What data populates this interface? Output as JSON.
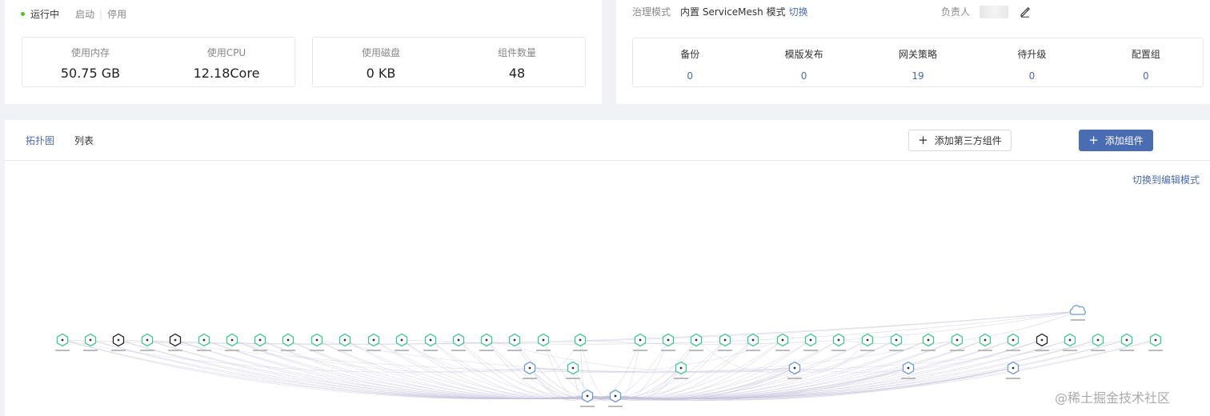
{
  "left_card": {
    "status": "运行中",
    "actions": [
      "启动",
      "停用"
    ],
    "metrics_a": [
      {
        "label": "使用内存",
        "value": "50.75 GB"
      },
      {
        "label": "使用CPU",
        "value": "12.18Core"
      }
    ],
    "metrics_b": [
      {
        "label": "使用磁盘",
        "value": "0 KB"
      },
      {
        "label": "组件数量",
        "value": "48"
      }
    ]
  },
  "right_card": {
    "gov_label": "治理模式",
    "gov_value": "内置 ServiceMesh 模式",
    "gov_switch": "切换",
    "owner_label": "负责人",
    "stats": [
      {
        "label": "备份",
        "value": "0"
      },
      {
        "label": "模版发布",
        "value": "0"
      },
      {
        "label": "网关策略",
        "value": "19"
      },
      {
        "label": "待升级",
        "value": "0"
      },
      {
        "label": "配置组",
        "value": "0"
      }
    ]
  },
  "bottom": {
    "tabs": [
      "拓扑图",
      "列表"
    ],
    "btn_third": "添加第三方组件",
    "btn_add": "添加组件",
    "switch_mode": "切换到编辑模式"
  },
  "colors": {
    "accent": "#4a6cb3",
    "running": "#52c41a",
    "node_green": "#3cc98a",
    "node_dark": "#222222",
    "node_blue": "#6c9bd2",
    "edge": "#c6c3dc"
  },
  "icons": [
    "edit-icon",
    "plus-icon",
    "cloud-icon",
    "hexagon-node-icon"
  ],
  "watermark": "@稀土掘金技术社区"
}
